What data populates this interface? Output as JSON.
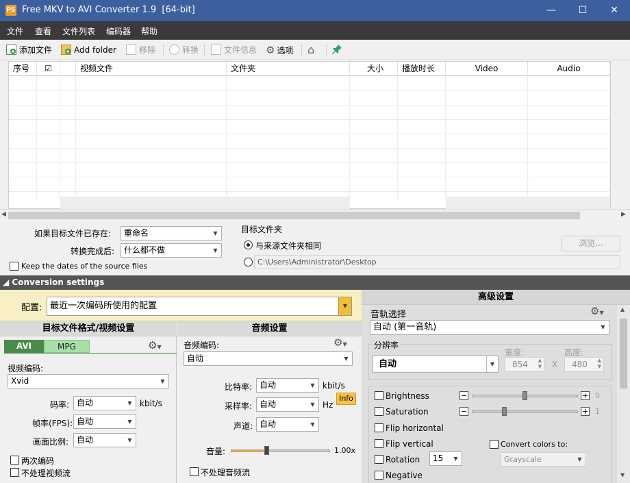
{
  "window": {
    "title": "Free MKV to AVI Converter 1.9  [64-bit]",
    "app_icon": "PS",
    "minimize": "—",
    "maximize": "☐",
    "close": "✕"
  },
  "menu": [
    "文件",
    "查看",
    "文件列表",
    "编码器",
    "帮助"
  ],
  "toolbar": {
    "add_file": "添加文件",
    "add_folder": "Add folder",
    "remove": "移除",
    "convert": "转换",
    "file_info": "文件信息",
    "options": "选项"
  },
  "grid": {
    "columns": [
      "序号",
      "☑",
      "视频文件",
      "文件夹",
      "大小",
      "播放时长",
      "Video",
      "Audio"
    ]
  },
  "options": {
    "if_exists_label": "如果目标文件已存在:",
    "if_exists_value": "重命名",
    "after_label": "转换完成后:",
    "after_value": "什么都不做",
    "keep_dates": "Keep the dates of the source files",
    "target_folder_label": "目标文件夹",
    "same_as_source": "与来源文件夹相同",
    "custom_path": "C:\\Users\\Administrator\\Desktop",
    "browse": "浏览..."
  },
  "conversion_settings": {
    "label": "◢ Conversion settings"
  },
  "preset": {
    "label": "配置:",
    "value": "最近一次编码所使用的配置"
  },
  "video": {
    "header": "目标文件格式/视频设置",
    "tab_avi": "AVI",
    "tab_mpg": "MPG",
    "codec_label": "视频编码:",
    "codec_value": "Xvid",
    "bitrate_label": "码率:",
    "bitrate_value": "自动",
    "bitrate_unit": "kbit/s",
    "fps_label": "帧率(FPS):",
    "fps_value": "自动",
    "aspect_label": "画面比例:",
    "aspect_value": "自动",
    "two_pass": "两次编码",
    "no_video": "不处理视频流"
  },
  "audio": {
    "header": "音频设置",
    "codec_label": "音频编码:",
    "codec_value": "自动",
    "bitrate_label": "比特率:",
    "bitrate_value": "自动",
    "bitrate_unit": "kbit/s",
    "info": "Info",
    "samplerate_label": "采样率:",
    "samplerate_value": "自动",
    "samplerate_unit": "Hz",
    "channels_label": "声道:",
    "channels_value": "自动",
    "volume_label": "音量:",
    "volume_value": "1.00x",
    "volume_level": 0.33,
    "no_audio": "不处理音频流"
  },
  "advanced": {
    "header": "高级设置",
    "track_label": "音轨选择",
    "track_value": "自动 (第一音轨)",
    "resolution_label": "分辨率",
    "resolution_value": "自动",
    "width_label": "宽度:",
    "width_value": "854",
    "height_label": "高度:",
    "height_value": "480",
    "x": "X",
    "brightness": "Brightness",
    "brightness_value": "0",
    "saturation": "Saturation",
    "saturation_value": "1",
    "flip_h": "Flip horizontal",
    "flip_v": "Flip vertical",
    "rotation": "Rotation",
    "rotation_value": "15",
    "negative": "Negative",
    "convert_colors": "Convert colors to:",
    "convert_colors_value": "Grayscale"
  },
  "colors": {
    "titlebar": "#3c5f9f",
    "menubar": "#3a3a3a",
    "avi_tab": "#4a8a4a",
    "mpg_tab": "#a6e0a6",
    "volume_fill": "#f0a830",
    "info_badge": "#f5c242"
  }
}
